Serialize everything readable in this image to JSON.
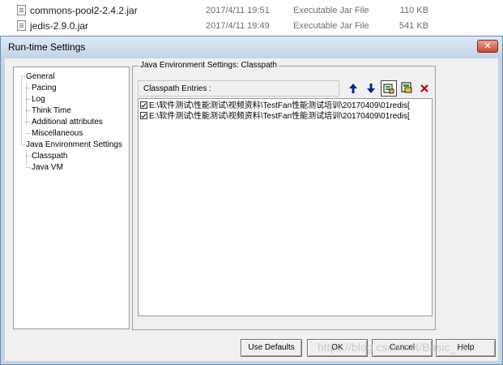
{
  "files": [
    {
      "name": "commons-pool2-2.4.2.jar",
      "date": "2017/4/11 19:51",
      "type": "Executable Jar File",
      "size": "110 KB"
    },
    {
      "name": "jedis-2.9.0.jar",
      "date": "2017/4/11 19:49",
      "type": "Executable Jar File",
      "size": "541 KB"
    }
  ],
  "dialog": {
    "title": "Run-time Settings",
    "close_label": "✕"
  },
  "tree": {
    "general": "General",
    "pacing": "Pacing",
    "log": "Log",
    "think_time": "Think Time",
    "additional_attributes": "Additional attributes",
    "miscellaneous": "Miscellaneous",
    "java_env": "Java Environment Settings",
    "classpath": "Classpath",
    "java_vm": "Java VM"
  },
  "classpath_panel": {
    "group_title": "Java Environment Settings: Classpath",
    "header": "Classpath Entries :",
    "entries": [
      "E:\\软件测试\\性能测试\\视频资料\\TestFan性能测试培训\\20170409\\01redis[",
      "E:\\软件测试\\性能测试\\视频资料\\TestFan性能测试培训\\20170409\\01redis["
    ],
    "toolbar_icons": [
      "arrow-up-icon",
      "arrow-down-icon",
      "browse-folder-icon",
      "add-jar-icon",
      "delete-icon"
    ]
  },
  "buttons": {
    "use_defaults": "Use Defaults",
    "ok": "OK",
    "cancel": "Cancel",
    "help": "Help"
  },
  "watermark": "https://blog.csdn.net/Basic_ra...",
  "colors": {
    "titlebar": "#c3d4e8",
    "client": "#f0f0f0",
    "arrow": "#0a2a8a",
    "delete": "#cc0000"
  }
}
